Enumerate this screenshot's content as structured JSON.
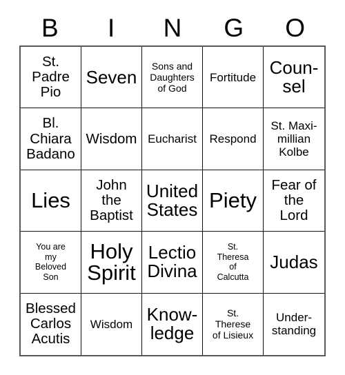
{
  "card": {
    "title_letters": [
      "B",
      "I",
      "N",
      "G",
      "O"
    ],
    "columns": 5,
    "rows": 5,
    "colors": {
      "background": "#ffffff",
      "text": "#000000",
      "grid_line": "#111111",
      "outer_border": "#575757"
    },
    "cells": [
      {
        "text": "St.\nPadre\nPio",
        "size": "lg"
      },
      {
        "text": "Seven",
        "size": "xl"
      },
      {
        "text": "Sons and\nDaughters\nof God",
        "size": "sm"
      },
      {
        "text": "Fortitude",
        "size": "md"
      },
      {
        "text": "Coun-\nsel",
        "size": "xl"
      },
      {
        "text": "Bl.\nChiara\nBadano",
        "size": "lg"
      },
      {
        "text": "Wisdom",
        "size": "lg"
      },
      {
        "text": "Eucharist",
        "size": "md"
      },
      {
        "text": "Respond",
        "size": "md"
      },
      {
        "text": "St. Maxi-\nmillian\nKolbe",
        "size": "md"
      },
      {
        "text": "Lies",
        "size": "xxl"
      },
      {
        "text": "John\nthe\nBaptist",
        "size": "lg"
      },
      {
        "text": "United\nStates",
        "size": "xl"
      },
      {
        "text": "Piety",
        "size": "xxl"
      },
      {
        "text": "Fear of\nthe\nLord",
        "size": "lg"
      },
      {
        "text": "You are\nmy\nBeloved\nSon",
        "size": "xs"
      },
      {
        "text": "Holy\nSpirit",
        "size": "xxl"
      },
      {
        "text": "Lectio\nDivina",
        "size": "xl"
      },
      {
        "text": "St.\nTheresa\nof\nCalcutta",
        "size": "xs"
      },
      {
        "text": "Judas",
        "size": "xl"
      },
      {
        "text": "Blessed\nCarlos\nAcutis",
        "size": "lg"
      },
      {
        "text": "Wisdom",
        "size": "md"
      },
      {
        "text": "Know-\nledge",
        "size": "xl"
      },
      {
        "text": "St.\nTherese\nof Lisieux",
        "size": "sm"
      },
      {
        "text": "Under-\nstanding",
        "size": "md"
      }
    ]
  }
}
